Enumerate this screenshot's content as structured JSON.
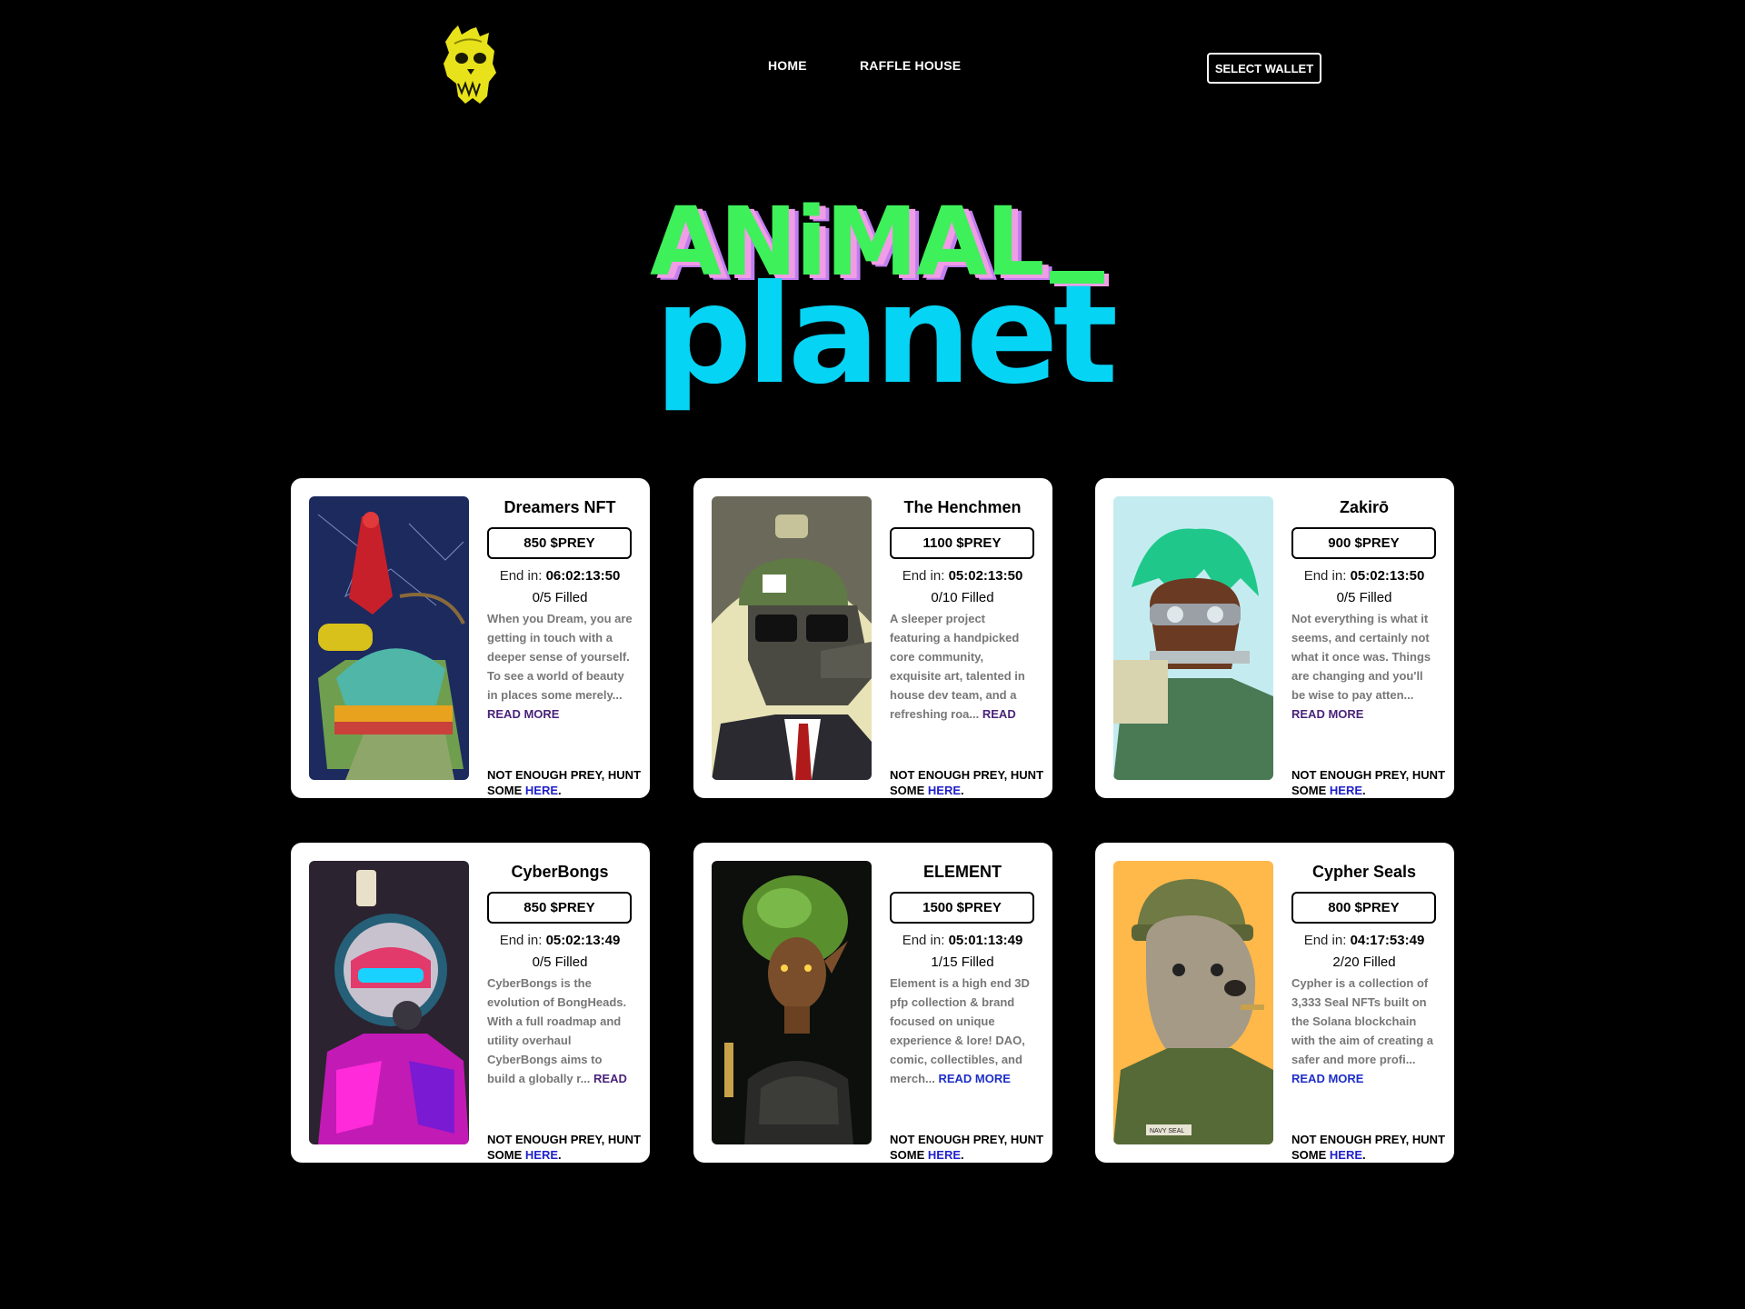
{
  "nav": {
    "home": "HOME",
    "raffle": "RAFFLE HOUSE",
    "wallet": "SELECT WALLET"
  },
  "hero": {
    "line1": "ANiMAL",
    "line2": "planet"
  },
  "cards": [
    {
      "name": "Dreamers NFT",
      "price": "850 $PREY",
      "ends_label": "End in:",
      "ends": "06:02:13:50",
      "filled": "0/5 Filled",
      "desc": "When you Dream, you are getting in touch with a deeper sense of yourself. To see a world of beauty in places some merely...",
      "more": "READ MORE",
      "prey": "NOT ENOUGH PREY, HUNT SOME",
      "here": "HERE"
    },
    {
      "name": "The Henchmen",
      "price": "1100 $PREY",
      "ends_label": "End in:",
      "ends": "05:02:13:50",
      "filled": "0/10 Filled",
      "desc": "A sleeper project featuring a handpicked core community, exquisite art, talented in house dev team, and a refreshing roa...",
      "more": "READ MORE",
      "prey": "NOT ENOUGH PREY, HUNT SOME",
      "here": "HERE"
    },
    {
      "name": "Zakirō",
      "price": "900 $PREY",
      "ends_label": "End in:",
      "ends": "05:02:13:50",
      "filled": "0/5 Filled",
      "desc": "Not everything is what it seems, and certainly not what it once was. Things are changing and you'll be wise to pay atten...",
      "more": "READ MORE",
      "prey": "NOT ENOUGH PREY, HUNT SOME",
      "here": "HERE"
    },
    {
      "name": "CyberBongs",
      "price": "850 $PREY",
      "ends_label": "End in:",
      "ends": "05:02:13:49",
      "filled": "0/5 Filled",
      "desc": "CyberBongs is the evolution of BongHeads. With a full roadmap and utility overhaul CyberBongs aims to build a globally r...",
      "more": "READ MORE",
      "prey": "NOT ENOUGH PREY, HUNT SOME",
      "here": "HERE"
    },
    {
      "name": "ELEMENT",
      "price": "1500 $PREY",
      "ends_label": "End in:",
      "ends": "05:01:13:49",
      "filled": "1/15 Filled",
      "desc": "Element is a high end 3D pfp collection & brand focused on unique experience & lore! DAO, comic, collectibles, and merch...",
      "more": "READ MORE",
      "prey": "NOT ENOUGH PREY, HUNT SOME",
      "here": "HERE"
    },
    {
      "name": "Cypher Seals",
      "price": "800 $PREY",
      "ends_label": "End in:",
      "ends": "04:17:53:49",
      "filled": "2/20 Filled",
      "desc": "Cypher is a collection of 3,333 Seal NFTs built on the Solana blockchain with the aim of creating a safer and more profi...",
      "more": "READ MORE",
      "prey": "NOT ENOUGH PREY, HUNT SOME",
      "here": "HERE"
    }
  ],
  "art_labels": {
    "navy_seal": "NAVY SEAL"
  },
  "colors": {
    "background": "#000000",
    "card": "#ffffff",
    "title_green": "#3ef05a",
    "title_pink": "#f09de6",
    "title_cyan": "#06d4f5",
    "logo_yellow": "#e8e21a",
    "link_blue": "#1f1fcc",
    "read_more_purple": "#4a237a"
  }
}
